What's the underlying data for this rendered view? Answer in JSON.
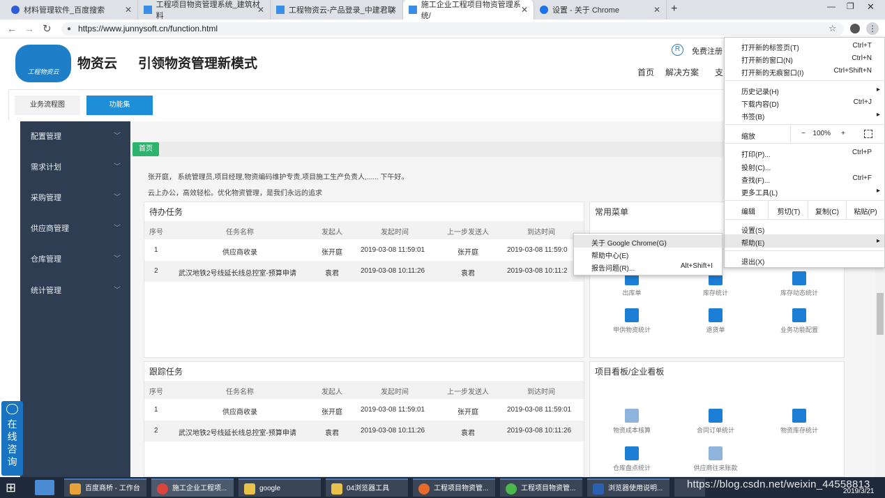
{
  "tabs": [
    {
      "label": "材料管理软件_百度搜索"
    },
    {
      "label": "工程项目物资管理系统_建筑材料"
    },
    {
      "label": "工程物资云-产品登录_中建君联"
    },
    {
      "label": "施工企业工程项目物资管理系统/"
    },
    {
      "label": "设置 - 关于 Chrome"
    }
  ],
  "address": {
    "url": "https://www.junnysoft.cn/function.html"
  },
  "header": {
    "brand": "物资云",
    "slogan": "引领物资管理新模式",
    "logo_text": "工程物资云",
    "register": "免费注册",
    "nav": [
      "首页",
      "解决方案",
      "支"
    ]
  },
  "subtabs": [
    "业务流程图",
    "功能集"
  ],
  "sidebar": {
    "items": [
      "配置管理",
      "需求计划",
      "采购管理",
      "供应商管理",
      "仓库管理",
      "统计管理"
    ]
  },
  "breadcrumb": "首页",
  "greeting": {
    "line1": "张开庭， 系统管理员,项目经理,物资编码维护专责,项目施工生产负责人,...... 下午好。",
    "line2": "云上办公，高效轻松。优化物资管理，是我们永远的追求"
  },
  "todo": {
    "title": "待办任务",
    "headers": [
      "序号",
      "任务名称",
      "发起人",
      "发起时间",
      "上一步发送人",
      "到达时间"
    ],
    "rows": [
      [
        "1",
        "供应商收录",
        "张开庭",
        "2019-03-08 11:59:01",
        "张开庭",
        "2019-03-08 11:59:0"
      ],
      [
        "2",
        "武汉地铁2号线延长线总控室-预算申请",
        "袁君",
        "2019-03-08 10:11:26",
        "袁君",
        "2019-03-08 10:11:2"
      ]
    ]
  },
  "track": {
    "title": "跟踪任务",
    "headers": [
      "序号",
      "任务名称",
      "发起人",
      "发起时间",
      "上一步发送人",
      "到达时间"
    ],
    "rows": [
      [
        "1",
        "供应商收录",
        "张开庭",
        "2019-03-08 11:59:01",
        "张开庭",
        "2019-03-08 11:59:01"
      ],
      [
        "2",
        "武汉地铁2号线延长线总控室-预算申请",
        "袁君",
        "2019-03-08 10:11:26",
        "袁君",
        "2019-03-08 10:11:26"
      ]
    ]
  },
  "common_menu": {
    "title": "常用菜单",
    "tiles": [
      "出库单",
      "库存统计",
      "库存动态统计",
      "甲供物资统计",
      "退货单",
      "业务功能配置"
    ]
  },
  "boards": {
    "title": "项目看板/企业看板",
    "tiles": [
      "物资成本核算",
      "合同订单统计",
      "物资库存统计",
      "仓库盘点统计",
      "供应商往来账款"
    ]
  },
  "chrome_menu": {
    "items": [
      {
        "label": "打开新的标签页(T)",
        "key": "Ctrl+T"
      },
      {
        "label": "打开新的窗口(N)",
        "key": "Ctrl+N"
      },
      {
        "label": "打开新的无痕窗口(I)",
        "key": "Ctrl+Shift+N"
      },
      {
        "label": "历史记录(H)",
        "key": ""
      },
      {
        "label": "下载内容(D)",
        "key": "Ctrl+J"
      },
      {
        "label": "书签(B)",
        "key": ""
      },
      {
        "label": "缩放",
        "key": ""
      },
      {
        "label": "打印(P)...",
        "key": "Ctrl+P"
      },
      {
        "label": "投射(C)...",
        "key": ""
      },
      {
        "label": "查找(F)...",
        "key": "Ctrl+F"
      },
      {
        "label": "更多工具(L)",
        "key": ""
      },
      {
        "label": "设置(S)",
        "key": ""
      },
      {
        "label": "帮助(E)",
        "key": ""
      },
      {
        "label": "退出(X)",
        "key": ""
      }
    ],
    "zoom": {
      "minus": "−",
      "value": "100%",
      "plus": "+"
    },
    "edit": {
      "label": "编辑",
      "cut": "剪切(T)",
      "copy": "复制(C)",
      "paste": "粘贴(P)"
    }
  },
  "help_submenu": [
    {
      "label": "关于 Google Chrome(G)",
      "key": ""
    },
    {
      "label": "帮助中心(E)",
      "key": ""
    },
    {
      "label": "报告问题(R)...",
      "key": "Alt+Shift+I"
    }
  ],
  "chat": "在线咨询",
  "taskbar": {
    "items": [
      "百度商桥 - 工作台",
      "施工企业工程项...",
      "google",
      "04浏览器工具",
      "工程项目物资管...",
      "工程项目物资管...",
      "浏览器使用说明..."
    ],
    "clock": "2019/3/21",
    "watermark": "https://blog.csdn.net/weixin_44558813"
  }
}
